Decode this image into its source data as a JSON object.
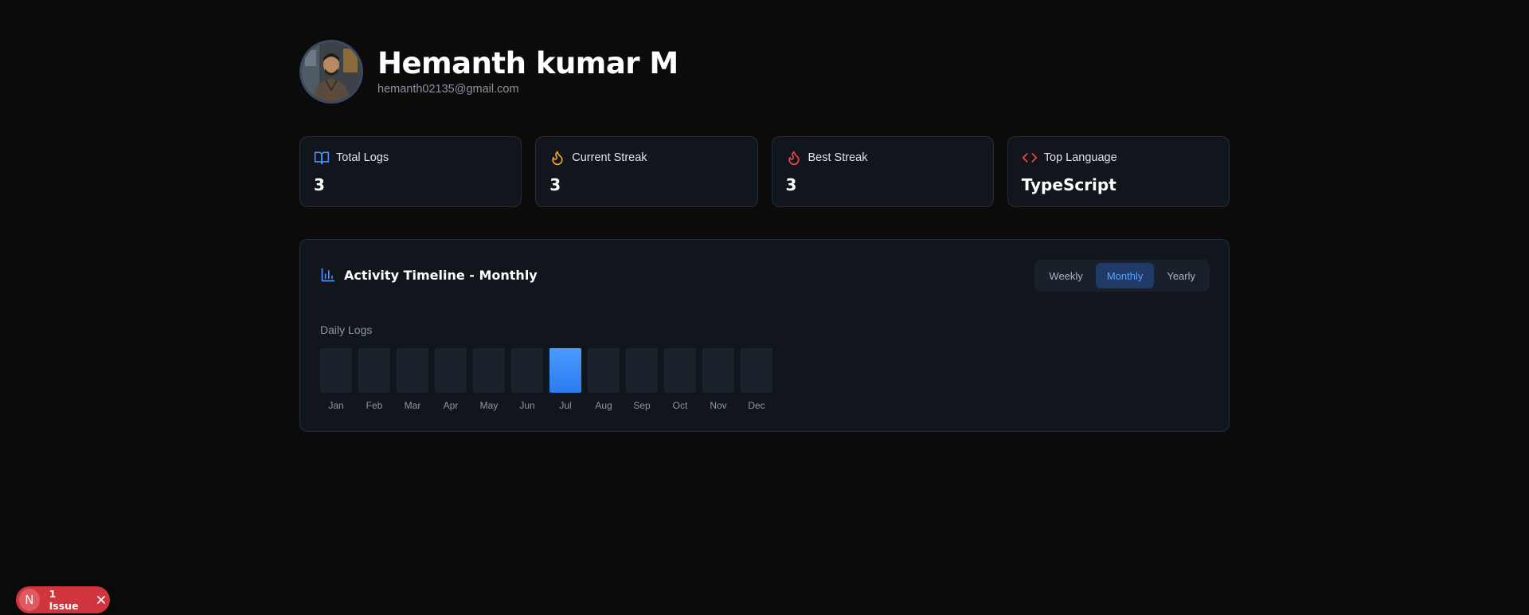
{
  "profile": {
    "name": "Hemanth kumar M",
    "email": "hemanth02135@gmail.com"
  },
  "stats": [
    {
      "label": "Total Logs",
      "value": "3",
      "icon": "book-open-icon",
      "icon_color": "#4e8fff"
    },
    {
      "label": "Current Streak",
      "value": "3",
      "icon": "flame-icon",
      "icon_color": "#f59e2b"
    },
    {
      "label": "Best Streak",
      "value": "3",
      "icon": "flame-icon",
      "icon_color": "#ef4444"
    },
    {
      "label": "Top Language",
      "value": "TypeScript",
      "icon": "code-icon",
      "icon_color": "#ef4444"
    }
  ],
  "timeline": {
    "title": "Activity Timeline - Monthly",
    "icon": "bar-chart-icon",
    "tabs": [
      "Weekly",
      "Monthly",
      "Yearly"
    ],
    "active_tab": "Monthly",
    "chart_label": "Daily Logs"
  },
  "chart_data": {
    "type": "bar",
    "categories": [
      "Jan",
      "Feb",
      "Mar",
      "Apr",
      "May",
      "Jun",
      "Jul",
      "Aug",
      "Sep",
      "Oct",
      "Nov",
      "Dec"
    ],
    "values": [
      0,
      0,
      0,
      0,
      0,
      0,
      3,
      0,
      0,
      0,
      0,
      0
    ],
    "title": "Daily Logs",
    "grid": false
  },
  "issue_badge": {
    "logo_letter": "N",
    "text": "1 Issue"
  },
  "colors": {
    "accent": "#3b8cff",
    "background": "#0b0b0c",
    "card": "#11151c",
    "issue_red": "#d0343d"
  }
}
